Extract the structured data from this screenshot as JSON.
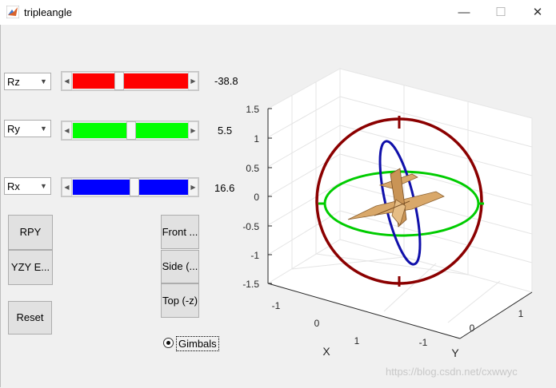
{
  "window": {
    "title": "tripleangle",
    "minimize_glyph": "—",
    "maximize_glyph": "☐",
    "close_glyph": "✕"
  },
  "controls": {
    "rows": [
      {
        "axis": "Rz",
        "value": "-38.8",
        "color": "#ff0000",
        "fraction": 0.43
      },
      {
        "axis": "Ry",
        "value": "5.5",
        "color": "#00ff00",
        "fraction": 0.52
      },
      {
        "axis": "Rx",
        "value": "16.6",
        "color": "#0000ff",
        "fraction": 0.55
      }
    ],
    "buttons": {
      "rpy": "RPY",
      "yzy": "YZY E...",
      "reset": "Reset",
      "front": "Front ...",
      "side": "Side (...",
      "top": "Top (-z)"
    },
    "gimbals_label": "Gimbals",
    "gimbals_checked": true
  },
  "plot": {
    "z_ticks": [
      "1.5",
      "1",
      "0.5",
      "0",
      "-0.5",
      "-1",
      "-1.5"
    ],
    "x_ticks": [
      "-1",
      "0",
      "1"
    ],
    "y_ticks": [
      "-1",
      "0",
      "1"
    ],
    "xlabel": "X",
    "ylabel": "Y",
    "ring_colors": {
      "outer": "#8b0000",
      "middle": "#00cc00",
      "inner": "#1010aa"
    },
    "aircraft_color": "#d9a86a"
  },
  "watermark": "https://blog.csdn.net/cxwwyc"
}
